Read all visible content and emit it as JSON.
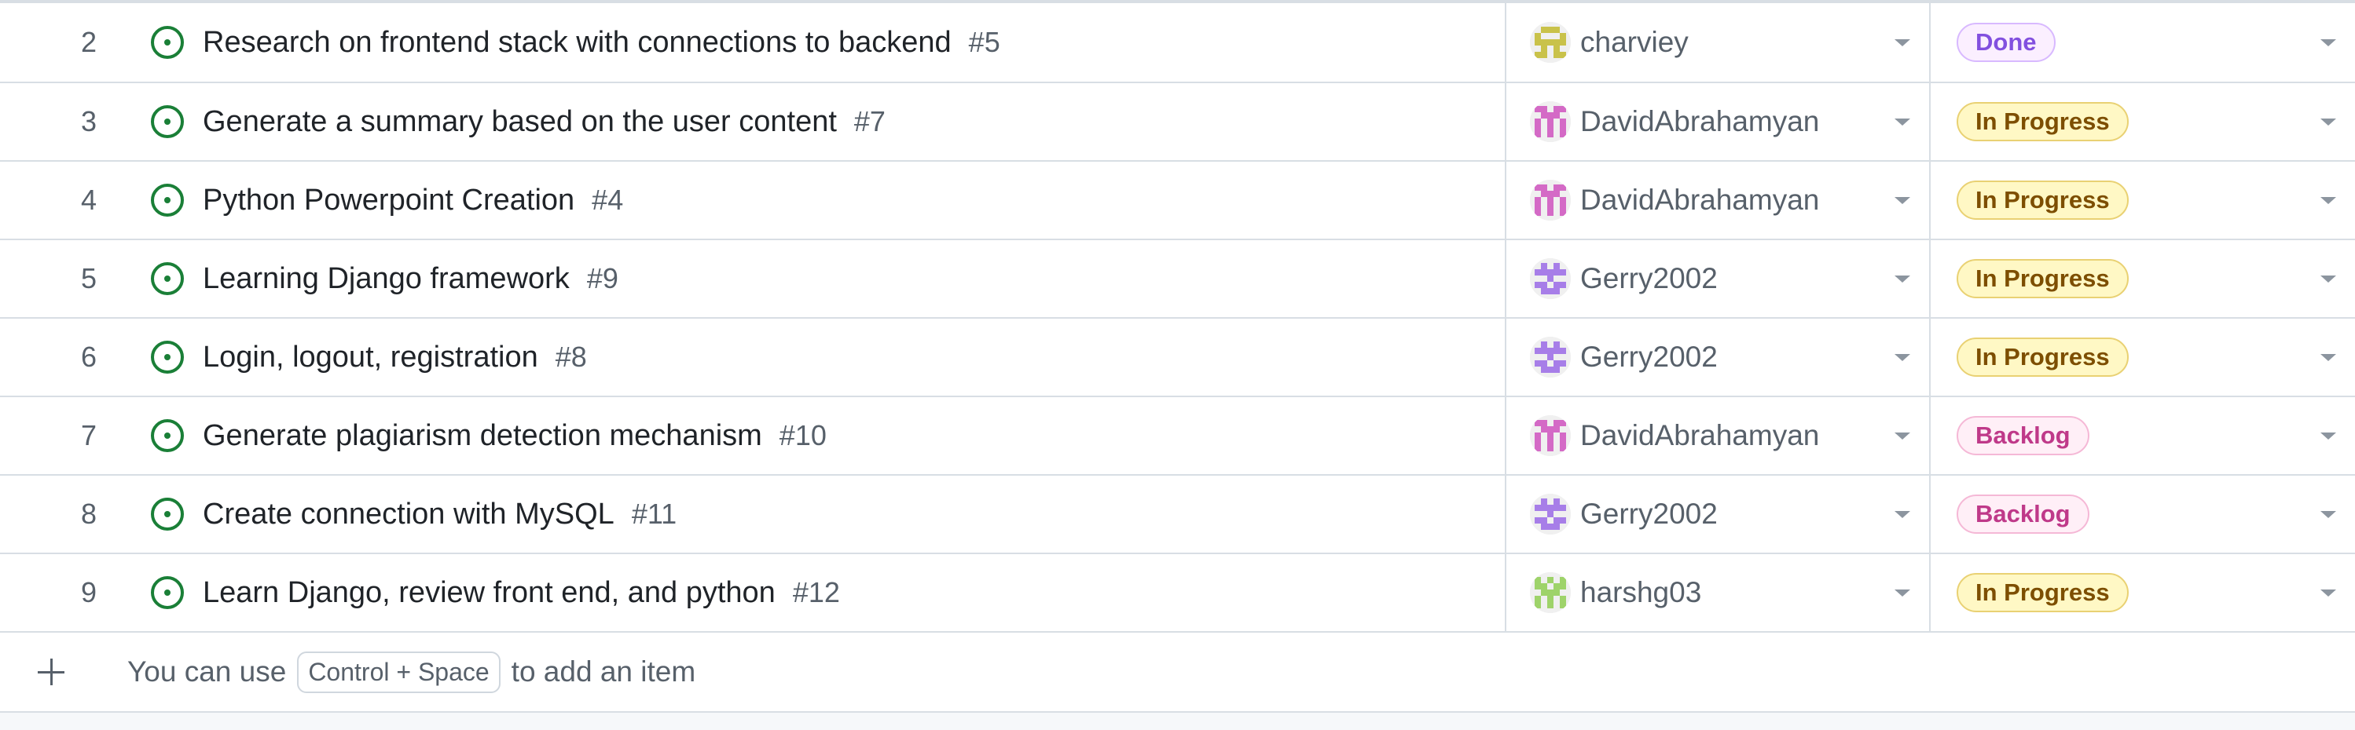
{
  "rows": [
    {
      "num": "2",
      "title": "Research on frontend stack with connections to backend",
      "issue": "#5",
      "assignee": "charviey",
      "avatar": "olive",
      "status": "Done",
      "status_kind": "done"
    },
    {
      "num": "3",
      "title": "Generate a summary based on the user content",
      "issue": "#7",
      "assignee": "DavidAbrahamyan",
      "avatar": "pink",
      "status": "In Progress",
      "status_kind": "progress"
    },
    {
      "num": "4",
      "title": "Python Powerpoint Creation",
      "issue": "#4",
      "assignee": "DavidAbrahamyan",
      "avatar": "pink",
      "status": "In Progress",
      "status_kind": "progress"
    },
    {
      "num": "5",
      "title": "Learning Django framework",
      "issue": "#9",
      "assignee": "Gerry2002",
      "avatar": "purple",
      "status": "In Progress",
      "status_kind": "progress"
    },
    {
      "num": "6",
      "title": "Login, logout, registration",
      "issue": "#8",
      "assignee": "Gerry2002",
      "avatar": "purple",
      "status": "In Progress",
      "status_kind": "progress"
    },
    {
      "num": "7",
      "title": "Generate plagiarism detection mechanism",
      "issue": "#10",
      "assignee": "DavidAbrahamyan",
      "avatar": "pink",
      "status": "Backlog",
      "status_kind": "backlog"
    },
    {
      "num": "8",
      "title": "Create connection with MySQL",
      "issue": "#11",
      "assignee": "Gerry2002",
      "avatar": "purple",
      "status": "Backlog",
      "status_kind": "backlog"
    },
    {
      "num": "9",
      "title": "Learn Django, review front end, and python",
      "issue": "#12",
      "assignee": "harshg03",
      "avatar": "green",
      "status": "In Progress",
      "status_kind": "progress"
    }
  ],
  "add_item": {
    "prefix": "You can use",
    "shortcut": "Control + Space",
    "suffix": "to add an item"
  },
  "colors": {
    "issue_open": "#1a7f37",
    "avatar_olive": "#c9c24a",
    "avatar_pink": "#d46ac6",
    "avatar_purple": "#a77ee8",
    "avatar_green": "#9ed36a"
  },
  "icons": {
    "issue": "issue-opened-icon",
    "add": "plus-icon",
    "dropdown": "triangle-down-icon"
  }
}
